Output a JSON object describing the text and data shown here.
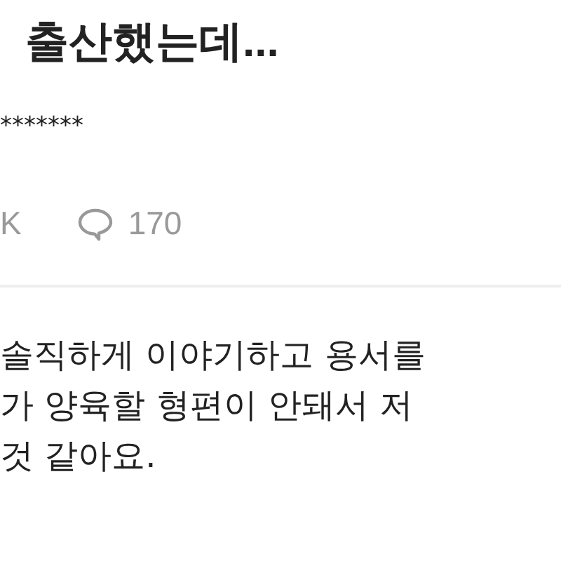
{
  "post": {
    "title": "출산했는데...",
    "author": "*******",
    "views": "K",
    "comments": "170"
  },
  "body": {
    "lines": [
      "솔직하게 이야기하고 용서를",
      "가 양육할 형편이 안돼서 저",
      "것 같아요."
    ]
  }
}
